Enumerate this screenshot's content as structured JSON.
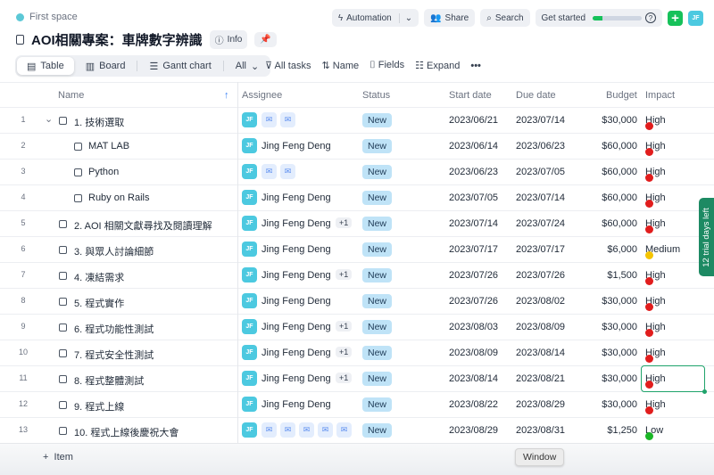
{
  "breadcrumb": "First space",
  "title": "AOI相關專案：車牌數字辨識",
  "info_label": "Info",
  "topbar": {
    "automation": "Automation",
    "share": "Share",
    "search": "Search",
    "get_started": "Get started",
    "progress_percent": 20,
    "avatar": "JF"
  },
  "views": {
    "table": "Table",
    "board": "Board",
    "gantt": "Gantt chart",
    "all": "All"
  },
  "tools": {
    "filter": "All tasks",
    "sort": "Name",
    "fields": "Fields",
    "expand": "Expand"
  },
  "columns": {
    "name": "Name",
    "assignee": "Assignee",
    "status": "Status",
    "start": "Start date",
    "due": "Due date",
    "budget": "Budget",
    "impact": "Impact"
  },
  "impact_colors": {
    "High": "#e11d1d",
    "Medium": "#f5c400",
    "Low": "#1bb626"
  },
  "rows": [
    {
      "n": "1",
      "name": "1. 技術選取",
      "sub": false,
      "expand": true,
      "assignee": null,
      "chips": 2,
      "extra": null,
      "status": "New",
      "start": "2023/06/21",
      "due": "2023/07/14",
      "budget": "$30,000",
      "impact": "High"
    },
    {
      "n": "2",
      "name": "MAT LAB",
      "sub": true,
      "assignee": "Jing Feng Deng",
      "chips": 0,
      "extra": null,
      "status": "New",
      "start": "2023/06/14",
      "due": "2023/06/23",
      "budget": "$60,000",
      "impact": "High"
    },
    {
      "n": "3",
      "name": "Python",
      "sub": true,
      "assignee": null,
      "chips": 2,
      "extra": null,
      "status": "New",
      "start": "2023/06/23",
      "due": "2023/07/05",
      "budget": "$60,000",
      "impact": "High"
    },
    {
      "n": "4",
      "name": "Ruby on Rails",
      "sub": true,
      "assignee": "Jing Feng Deng",
      "chips": 0,
      "extra": null,
      "status": "New",
      "start": "2023/07/05",
      "due": "2023/07/14",
      "budget": "$60,000",
      "impact": "High"
    },
    {
      "n": "5",
      "name": "2. AOI 相關文獻尋找及閱讀理解",
      "sub": false,
      "assignee": "Jing Feng Deng",
      "chips": 0,
      "extra": "+1",
      "status": "New",
      "start": "2023/07/14",
      "due": "2023/07/24",
      "budget": "$60,000",
      "impact": "High"
    },
    {
      "n": "6",
      "name": "3. 與眾人討論細節",
      "sub": false,
      "assignee": "Jing Feng Deng",
      "chips": 0,
      "extra": null,
      "status": "New",
      "start": "2023/07/17",
      "due": "2023/07/17",
      "budget": "$6,000",
      "impact": "Medium"
    },
    {
      "n": "7",
      "name": "4. 凍結需求",
      "sub": false,
      "assignee": "Jing Feng Deng",
      "chips": 0,
      "extra": "+1",
      "status": "New",
      "start": "2023/07/26",
      "due": "2023/07/26",
      "budget": "$1,500",
      "impact": "High"
    },
    {
      "n": "8",
      "name": "5. 程式實作",
      "sub": false,
      "assignee": "Jing Feng Deng",
      "chips": 0,
      "extra": null,
      "status": "New",
      "start": "2023/07/26",
      "due": "2023/08/02",
      "budget": "$30,000",
      "impact": "High"
    },
    {
      "n": "9",
      "name": "6. 程式功能性測試",
      "sub": false,
      "assignee": "Jing Feng Deng",
      "chips": 0,
      "extra": "+1",
      "status": "New",
      "start": "2023/08/03",
      "due": "2023/08/09",
      "budget": "$30,000",
      "impact": "High"
    },
    {
      "n": "10",
      "name": "7. 程式安全性測試",
      "sub": false,
      "assignee": "Jing Feng Deng",
      "chips": 0,
      "extra": "+1",
      "status": "New",
      "start": "2023/08/09",
      "due": "2023/08/14",
      "budget": "$30,000",
      "impact": "High"
    },
    {
      "n": "11",
      "name": "8. 程式整體測試",
      "sub": false,
      "assignee": "Jing Feng Deng",
      "chips": 0,
      "extra": "+1",
      "status": "New",
      "start": "2023/08/14",
      "due": "2023/08/21",
      "budget": "$30,000",
      "impact": "High"
    },
    {
      "n": "12",
      "name": "9. 程式上線",
      "sub": false,
      "assignee": "Jing Feng Deng",
      "chips": 0,
      "extra": null,
      "status": "New",
      "start": "2023/08/22",
      "due": "2023/08/29",
      "budget": "$30,000",
      "impact": "High"
    },
    {
      "n": "13",
      "name": "10. 程式上線後慶祝大會",
      "sub": false,
      "assignee": null,
      "chips": 5,
      "extra": null,
      "status": "New",
      "start": "2023/08/29",
      "due": "2023/08/31",
      "budget": "$1,250",
      "impact": "Low"
    }
  ],
  "add_item": "Item",
  "trial": "12 trial days left",
  "tooltip": "Window"
}
